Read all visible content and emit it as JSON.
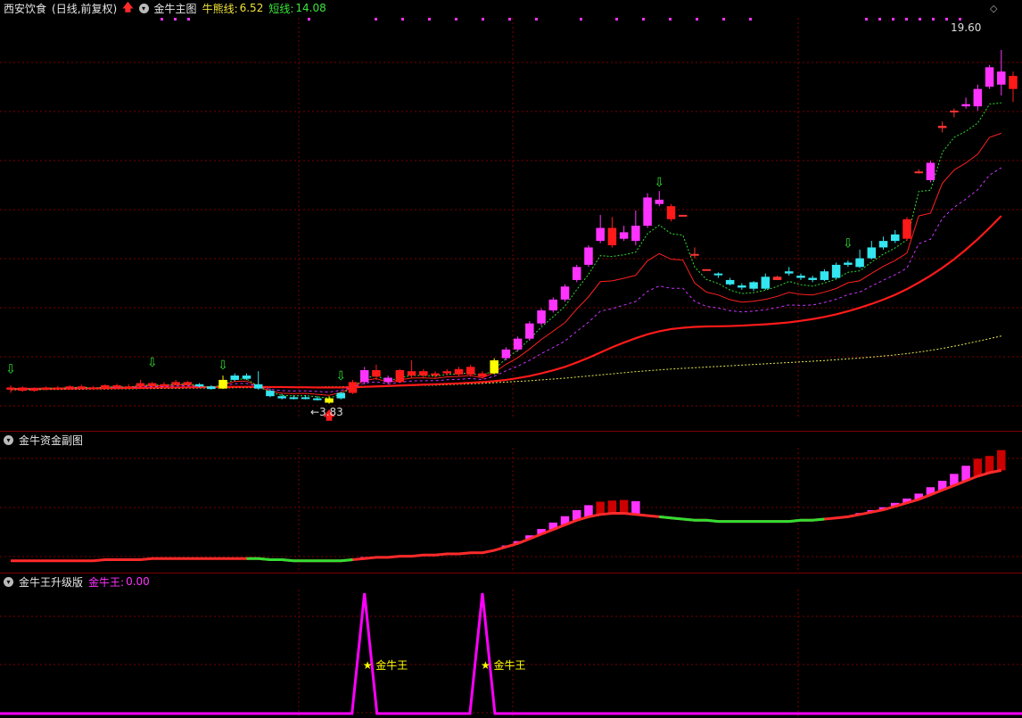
{
  "main": {
    "symbol": "西安饮食",
    "period": "(日线,前复权)",
    "indicator": "金牛主图",
    "bull_label": "牛熊线:",
    "bull_value": "6.52",
    "short_label": "短线:",
    "short_value": "14.08",
    "high_label": "19.60",
    "low_label": "3.83",
    "icons": [
      "arrow-up-icon",
      "chevron-down-icon",
      "diamond-icon"
    ]
  },
  "sub1": {
    "title": "金牛资金副图"
  },
  "sub2": {
    "title": "金牛王升级版",
    "value_label": "金牛王:",
    "value": "0.00",
    "signal_text": "金牛王"
  },
  "colors": {
    "up": "#ff33ff",
    "down": "#ff1a1a",
    "cyan": "#33e6f0",
    "yellow": "#ffff00",
    "grid": "#7a0000",
    "signal": "#ff00ff"
  },
  "chart_data": {
    "type": "candlestick",
    "price_range": [
      3.0,
      20.5
    ],
    "candles": [
      [
        3.95,
        4.05,
        4.15,
        3.8,
        "d"
      ],
      [
        4.05,
        3.9,
        4.1,
        3.85,
        "d"
      ],
      [
        3.9,
        3.98,
        4.05,
        3.85,
        "d"
      ],
      [
        3.98,
        4.05,
        4.1,
        3.92,
        "d"
      ],
      [
        4.05,
        4.0,
        4.12,
        3.95,
        "d"
      ],
      [
        4.0,
        4.1,
        4.15,
        3.95,
        "d"
      ],
      [
        4.1,
        4.05,
        4.18,
        4.0,
        "d"
      ],
      [
        4.05,
        4.0,
        4.12,
        3.95,
        "d"
      ],
      [
        4.0,
        4.15,
        4.2,
        3.95,
        "d"
      ],
      [
        4.15,
        4.05,
        4.22,
        4.0,
        "d"
      ],
      [
        4.05,
        4.1,
        4.2,
        4.0,
        "d"
      ],
      [
        4.1,
        4.25,
        4.4,
        4.05,
        "d"
      ],
      [
        4.25,
        4.15,
        4.3,
        4.1,
        "d"
      ],
      [
        4.15,
        4.2,
        4.3,
        4.1,
        "d"
      ],
      [
        4.2,
        4.3,
        4.4,
        4.15,
        "d"
      ],
      [
        4.3,
        4.2,
        4.35,
        4.15,
        "d"
      ],
      [
        4.2,
        4.1,
        4.25,
        4.05,
        "c"
      ],
      [
        4.1,
        3.98,
        4.15,
        3.95,
        "c"
      ],
      [
        4.0,
        4.4,
        4.6,
        3.98,
        "y"
      ],
      [
        4.4,
        4.6,
        4.7,
        4.35,
        "c"
      ],
      [
        4.6,
        4.45,
        4.7,
        4.4,
        "c"
      ],
      [
        4.2,
        4.0,
        4.8,
        3.95,
        "c"
      ],
      [
        3.9,
        3.65,
        4.0,
        3.6,
        "c"
      ],
      [
        3.65,
        3.55,
        3.75,
        3.5,
        "c"
      ],
      [
        3.55,
        3.6,
        3.7,
        3.5,
        "c"
      ],
      [
        3.6,
        3.58,
        3.7,
        3.5,
        "c"
      ],
      [
        3.55,
        3.5,
        3.65,
        3.45,
        "c"
      ],
      [
        3.35,
        3.55,
        3.65,
        3.3,
        "y"
      ],
      [
        3.55,
        3.8,
        3.85,
        3.5,
        "c"
      ],
      [
        3.8,
        4.3,
        4.4,
        3.75,
        "d"
      ],
      [
        4.3,
        4.85,
        5.0,
        4.2,
        "u"
      ],
      [
        4.85,
        4.55,
        5.1,
        4.4,
        "d"
      ],
      [
        4.5,
        4.3,
        4.6,
        4.2,
        "u"
      ],
      [
        4.3,
        4.85,
        4.9,
        4.25,
        "d"
      ],
      [
        4.6,
        4.8,
        5.3,
        4.5,
        "d"
      ],
      [
        4.8,
        4.6,
        4.9,
        4.5,
        "d"
      ],
      [
        4.6,
        4.7,
        4.8,
        4.5,
        "d"
      ],
      [
        4.7,
        4.8,
        4.9,
        4.6,
        "d"
      ],
      [
        4.9,
        4.65,
        5.0,
        4.55,
        "d"
      ],
      [
        4.65,
        5.0,
        5.1,
        4.55,
        "d"
      ],
      [
        4.55,
        4.7,
        4.8,
        4.45,
        "d"
      ],
      [
        4.7,
        5.3,
        5.4,
        4.65,
        "y"
      ],
      [
        5.4,
        5.8,
        5.9,
        5.3,
        "u"
      ],
      [
        5.8,
        6.3,
        6.4,
        5.7,
        "u"
      ],
      [
        6.3,
        7.0,
        7.1,
        6.2,
        "u"
      ],
      [
        7.0,
        7.6,
        7.7,
        6.9,
        "u"
      ],
      [
        7.6,
        8.1,
        8.2,
        7.5,
        "u"
      ],
      [
        8.1,
        8.7,
        8.8,
        8.0,
        "u"
      ],
      [
        9.0,
        9.6,
        9.7,
        8.9,
        "u"
      ],
      [
        9.7,
        10.5,
        10.6,
        9.6,
        "u"
      ],
      [
        10.8,
        11.4,
        12.0,
        10.7,
        "u"
      ],
      [
        11.4,
        10.6,
        11.9,
        10.5,
        "d"
      ],
      [
        10.9,
        11.2,
        11.5,
        10.8,
        "u"
      ],
      [
        10.8,
        11.5,
        12.2,
        10.6,
        "u"
      ],
      [
        11.5,
        12.8,
        13.0,
        11.4,
        "u"
      ],
      [
        12.5,
        12.7,
        13.1,
        12.4,
        "u"
      ],
      [
        12.4,
        11.8,
        12.5,
        11.7,
        "d"
      ],
      [
        12.0,
        12.0,
        12.0,
        12.0,
        "s"
      ],
      [
        10.2,
        10.2,
        10.5,
        10.0,
        "s"
      ],
      [
        9.5,
        9.5,
        9.5,
        9.5,
        "s"
      ],
      [
        9.3,
        9.25,
        9.35,
        9.1,
        "c"
      ],
      [
        9.0,
        8.8,
        9.1,
        8.75,
        "c"
      ],
      [
        8.75,
        8.65,
        8.85,
        8.55,
        "c"
      ],
      [
        8.9,
        8.6,
        8.95,
        8.5,
        "c"
      ],
      [
        8.6,
        9.15,
        9.3,
        8.55,
        "c"
      ],
      [
        9.15,
        9.0,
        9.2,
        9.0,
        "s"
      ],
      [
        9.4,
        9.3,
        9.6,
        9.2,
        "c"
      ],
      [
        9.2,
        9.1,
        9.3,
        9.0,
        "c"
      ],
      [
        9.1,
        9.0,
        9.2,
        8.9,
        "c"
      ],
      [
        9.0,
        9.4,
        9.5,
        8.95,
        "c"
      ],
      [
        9.1,
        9.7,
        9.8,
        9.05,
        "c"
      ],
      [
        9.7,
        9.8,
        9.9,
        9.6,
        "c"
      ],
      [
        9.6,
        10.0,
        10.4,
        9.55,
        "c"
      ],
      [
        10.0,
        10.5,
        10.8,
        9.95,
        "c"
      ],
      [
        10.5,
        10.8,
        11.0,
        10.4,
        "c"
      ],
      [
        10.8,
        11.1,
        11.3,
        10.7,
        "c"
      ],
      [
        11.8,
        10.9,
        11.9,
        10.8,
        "d"
      ],
      [
        14.0,
        14.0,
        14.1,
        13.9,
        "s"
      ],
      [
        13.6,
        14.4,
        14.5,
        13.5,
        "u"
      ],
      [
        16.1,
        16.0,
        16.3,
        15.8,
        "s"
      ],
      [
        16.8,
        16.8,
        16.9,
        16.5,
        "s"
      ],
      [
        17.0,
        17.1,
        17.4,
        16.9,
        "u"
      ],
      [
        17.0,
        17.8,
        18.0,
        16.8,
        "u"
      ],
      [
        17.9,
        18.8,
        18.9,
        17.8,
        "u"
      ],
      [
        18.0,
        18.6,
        19.6,
        17.5,
        "u"
      ],
      [
        18.4,
        17.8,
        18.6,
        17.2,
        "d"
      ]
    ],
    "ma_bull": [
      3.98,
      3.98,
      3.99,
      3.99,
      4.0,
      4.0,
      4.01,
      4.01,
      4.02,
      4.02,
      4.03,
      4.03,
      4.04,
      4.05,
      4.05,
      4.06,
      4.06,
      4.07,
      4.07,
      4.08,
      4.08,
      4.08,
      4.07,
      4.07,
      4.06,
      4.06,
      4.05,
      4.05,
      4.05,
      4.06,
      4.08,
      4.1,
      4.12,
      4.14,
      4.16,
      4.18,
      4.2,
      4.22,
      4.24,
      4.27,
      4.3,
      4.34,
      4.4,
      4.48,
      4.58,
      4.7,
      4.84,
      5.0,
      5.2,
      5.42,
      5.66,
      5.9,
      6.12,
      6.32,
      6.5,
      6.64,
      6.74,
      6.8,
      6.84,
      6.86,
      6.87,
      6.88,
      6.9,
      6.93,
      6.96,
      7.0,
      7.05,
      7.12,
      7.2,
      7.3,
      7.42,
      7.56,
      7.72,
      7.9,
      8.1,
      8.32,
      8.58,
      8.88,
      9.2,
      9.56,
      9.96,
      10.4,
      10.88,
      11.4,
      11.95
    ],
    "ma_long": [
      3.94,
      3.95,
      3.95,
      3.96,
      3.96,
      3.97,
      3.97,
      3.98,
      3.98,
      3.99,
      3.99,
      4.0,
      4.0,
      4.01,
      4.01,
      4.02,
      4.02,
      4.03,
      4.03,
      4.04,
      4.04,
      4.05,
      4.05,
      4.06,
      4.06,
      4.07,
      4.07,
      4.08,
      4.08,
      4.09,
      4.1,
      4.11,
      4.12,
      4.13,
      4.14,
      4.15,
      4.16,
      4.18,
      4.2,
      4.22,
      4.24,
      4.27,
      4.3,
      4.33,
      4.36,
      4.4,
      4.44,
      4.48,
      4.53,
      4.58,
      4.63,
      4.68,
      4.73,
      4.78,
      4.82,
      4.86,
      4.9,
      4.93,
      4.96,
      4.99,
      5.02,
      5.05,
      5.08,
      5.11,
      5.14,
      5.17,
      5.2,
      5.23,
      5.26,
      5.29,
      5.33,
      5.37,
      5.41,
      5.45,
      5.5,
      5.55,
      5.61,
      5.68,
      5.76,
      5.85,
      5.95,
      6.06,
      6.18,
      6.3,
      6.42
    ]
  },
  "sub1_data": {
    "bars": [
      0,
      0,
      0,
      0,
      0,
      0,
      0,
      0,
      0,
      0,
      0,
      0,
      0,
      0,
      0,
      0,
      0,
      0,
      0,
      0,
      0,
      0,
      0,
      0,
      0,
      0,
      0,
      0,
      0,
      0,
      0.05,
      0,
      0,
      0,
      0,
      0,
      0,
      0,
      0,
      0,
      0,
      0,
      0.05,
      0.08,
      0.12,
      0.18,
      0.24,
      0.3,
      0.35,
      0.4,
      0.44,
      0.44,
      0.46,
      0.46,
      0,
      0,
      0,
      0,
      0,
      0,
      0,
      0,
      0,
      0,
      0,
      0,
      0,
      0,
      0,
      0,
      0,
      0,
      0.05,
      0.07,
      0.09,
      0.12,
      0.15,
      0.2,
      0.26,
      0.32,
      0.4,
      0.52,
      0.6,
      0.58,
      0.7,
      0.72,
      0.6
    ],
    "line": [
      0.04,
      0.04,
      0.04,
      0.04,
      0.04,
      0.04,
      0.04,
      0.04,
      0.05,
      0.05,
      0.05,
      0.05,
      0.06,
      0.06,
      0.06,
      0.06,
      0.06,
      0.06,
      0.06,
      0.06,
      0.06,
      0.06,
      0.05,
      0.05,
      0.04,
      0.04,
      0.04,
      0.04,
      0.04,
      0.05,
      0.06,
      0.07,
      0.07,
      0.08,
      0.08,
      0.09,
      0.09,
      0.1,
      0.1,
      0.11,
      0.11,
      0.13,
      0.16,
      0.19,
      0.23,
      0.27,
      0.31,
      0.35,
      0.39,
      0.42,
      0.44,
      0.45,
      0.45,
      0.44,
      0.43,
      0.42,
      0.41,
      0.4,
      0.39,
      0.39,
      0.38,
      0.38,
      0.38,
      0.38,
      0.38,
      0.38,
      0.38,
      0.39,
      0.39,
      0.4,
      0.41,
      0.42,
      0.44,
      0.46,
      0.48,
      0.51,
      0.54,
      0.57,
      0.61,
      0.65,
      0.69,
      0.73,
      0.77,
      0.8,
      0.82
    ]
  },
  "sub2_data": {
    "peaks": [
      30,
      40
    ]
  }
}
